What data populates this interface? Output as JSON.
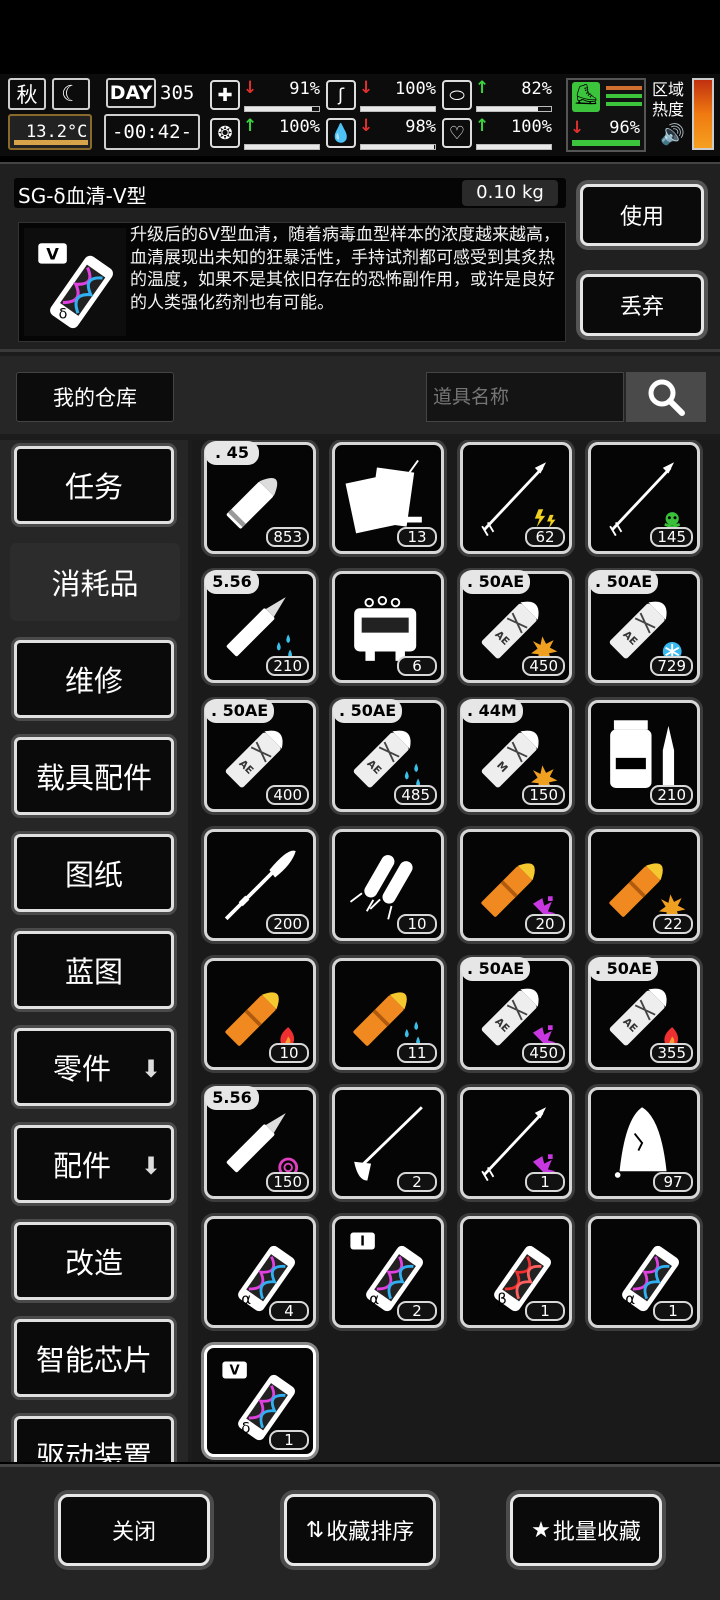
{
  "status": {
    "season": "秋",
    "temperature": "13.2°C",
    "day_label": "DAY",
    "day_number": "305",
    "clock": "-00:42-",
    "stats": [
      {
        "icon": "medkit-icon",
        "trend": "down",
        "value": "91%",
        "level": 0.91
      },
      {
        "icon": "stomach-icon",
        "trend": "down",
        "value": "100%",
        "level": 1.0
      },
      {
        "icon": "capsule-icon",
        "trend": "up",
        "value": "82%",
        "level": 0.82
      },
      {
        "icon": "brain-icon",
        "trend": "up",
        "value": "100%",
        "level": 1.0
      },
      {
        "icon": "water-drop-icon",
        "trend": "down",
        "value": "98%",
        "level": 0.98
      },
      {
        "icon": "heart-icon",
        "trend": "up",
        "value": "100%",
        "level": 1.0
      }
    ],
    "stamina": {
      "icon": "boot-icon",
      "trend": "down",
      "value": "96%",
      "level": 0.96
    },
    "zone_heat_label": "区域热度"
  },
  "item": {
    "name": "SG-δ血清-V型",
    "weight": "0.10 kg",
    "description": "升级后的δV型血清，随着病毒血型样本的浓度越来越高，血清展现出未知的狂暴活性，手持试剂都可感受到其炙热的温度，如果不是其依旧存在的恐怖副作用，或许是良好的人类强化药剂也有可能。",
    "use_label": "使用",
    "discard_label": "丢弃"
  },
  "warehouse": {
    "label": "我的仓库",
    "search_placeholder": "道具名称"
  },
  "categories": [
    {
      "label": "任务"
    },
    {
      "label": "消耗品",
      "selected": true
    },
    {
      "label": "维修"
    },
    {
      "label": "载具配件"
    },
    {
      "label": "图纸"
    },
    {
      "label": "蓝图"
    },
    {
      "label": "零件",
      "dropdown": true
    },
    {
      "label": "配件",
      "dropdown": true
    },
    {
      "label": "改造"
    },
    {
      "label": "智能芯片"
    },
    {
      "label": "驱动装置"
    }
  ],
  "items": [
    {
      "name": "pistol-round-45",
      "tag": ". 45",
      "count": "853",
      "kind": "bullet",
      "color": "#e8e8e8",
      "effect": ""
    },
    {
      "name": "supply-bundle",
      "count": "13",
      "kind": "bundle"
    },
    {
      "name": "shock-arrow",
      "count": "62",
      "kind": "arrow",
      "effect": "bolt"
    },
    {
      "name": "poison-arrow",
      "count": "145",
      "kind": "arrow",
      "effect": "skull"
    },
    {
      "name": "rifle-round-556-water",
      "tag": "5.56",
      "count": "210",
      "kind": "rifle",
      "effect": "drops"
    },
    {
      "name": "machine-part",
      "count": "6",
      "kind": "machine"
    },
    {
      "name": "round-50ae-explosive",
      "tag": ". 50AE",
      "count": "450",
      "kind": "shell",
      "letter": "AE",
      "effect": "burst"
    },
    {
      "name": "round-50ae-freeze",
      "tag": ". 50AE",
      "count": "729",
      "kind": "shell",
      "letter": "AE",
      "effect": "freeze"
    },
    {
      "name": "round-50ae-plain",
      "tag": ". 50AE",
      "count": "400",
      "kind": "shell",
      "letter": "AE",
      "effect": ""
    },
    {
      "name": "round-50ae-water",
      "tag": ". 50AE",
      "count": "485",
      "kind": "shell",
      "letter": "AE",
      "effect": "drops"
    },
    {
      "name": "round-44m-explosive",
      "tag": ". 44M",
      "count": "150",
      "kind": "shell",
      "letter": "M",
      "effect": "burst"
    },
    {
      "name": "medicine-vial",
      "count": "210",
      "kind": "vial"
    },
    {
      "name": "feather-dart",
      "count": "200",
      "kind": "dart"
    },
    {
      "name": "twin-rocket",
      "count": "10",
      "kind": "rocket"
    },
    {
      "name": "gold-round-shatter",
      "count": "20",
      "kind": "gold",
      "effect": "shatter"
    },
    {
      "name": "gold-round-explosive",
      "count": "22",
      "kind": "gold",
      "effect": "burst"
    },
    {
      "name": "gold-round-fire",
      "count": "10",
      "kind": "gold",
      "effect": "fire"
    },
    {
      "name": "gold-round-water",
      "count": "11",
      "kind": "gold",
      "effect": "drops"
    },
    {
      "name": "round-50ae-shatter",
      "tag": ". 50AE",
      "count": "450",
      "kind": "shell",
      "letter": "AE",
      "effect": "shatter"
    },
    {
      "name": "round-50ae-fire",
      "tag": ". 50AE",
      "count": "355",
      "kind": "shell",
      "letter": "AE",
      "effect": "fire"
    },
    {
      "name": "rifle-round-556-spiral",
      "tag": "5.56",
      "count": "150",
      "kind": "rifle",
      "effect": "spiral"
    },
    {
      "name": "brush-spear",
      "count": "2",
      "kind": "brush"
    },
    {
      "name": "shatter-arrow",
      "count": "1",
      "kind": "arrow",
      "effect": "shatter"
    },
    {
      "name": "cloth-sack",
      "count": "97",
      "kind": "sack"
    },
    {
      "name": "serum-alpha-broken",
      "count": "4",
      "kind": "serum",
      "letter": "α",
      "badge": ""
    },
    {
      "name": "serum-alpha-i",
      "count": "2",
      "kind": "serum",
      "letter": "α",
      "badge": "I"
    },
    {
      "name": "serum-beta",
      "count": "1",
      "kind": "serum",
      "letter": "β",
      "badge": ""
    },
    {
      "name": "serum-alpha",
      "count": "1",
      "kind": "serum",
      "letter": "α",
      "badge": ""
    },
    {
      "name": "serum-delta-v",
      "count": "1",
      "kind": "serum",
      "letter": "δ",
      "badge": "V",
      "selected": true
    }
  ],
  "bottom": {
    "close_label": "关闭",
    "sort_label": "收藏排序",
    "batch_label": "批量收藏"
  }
}
